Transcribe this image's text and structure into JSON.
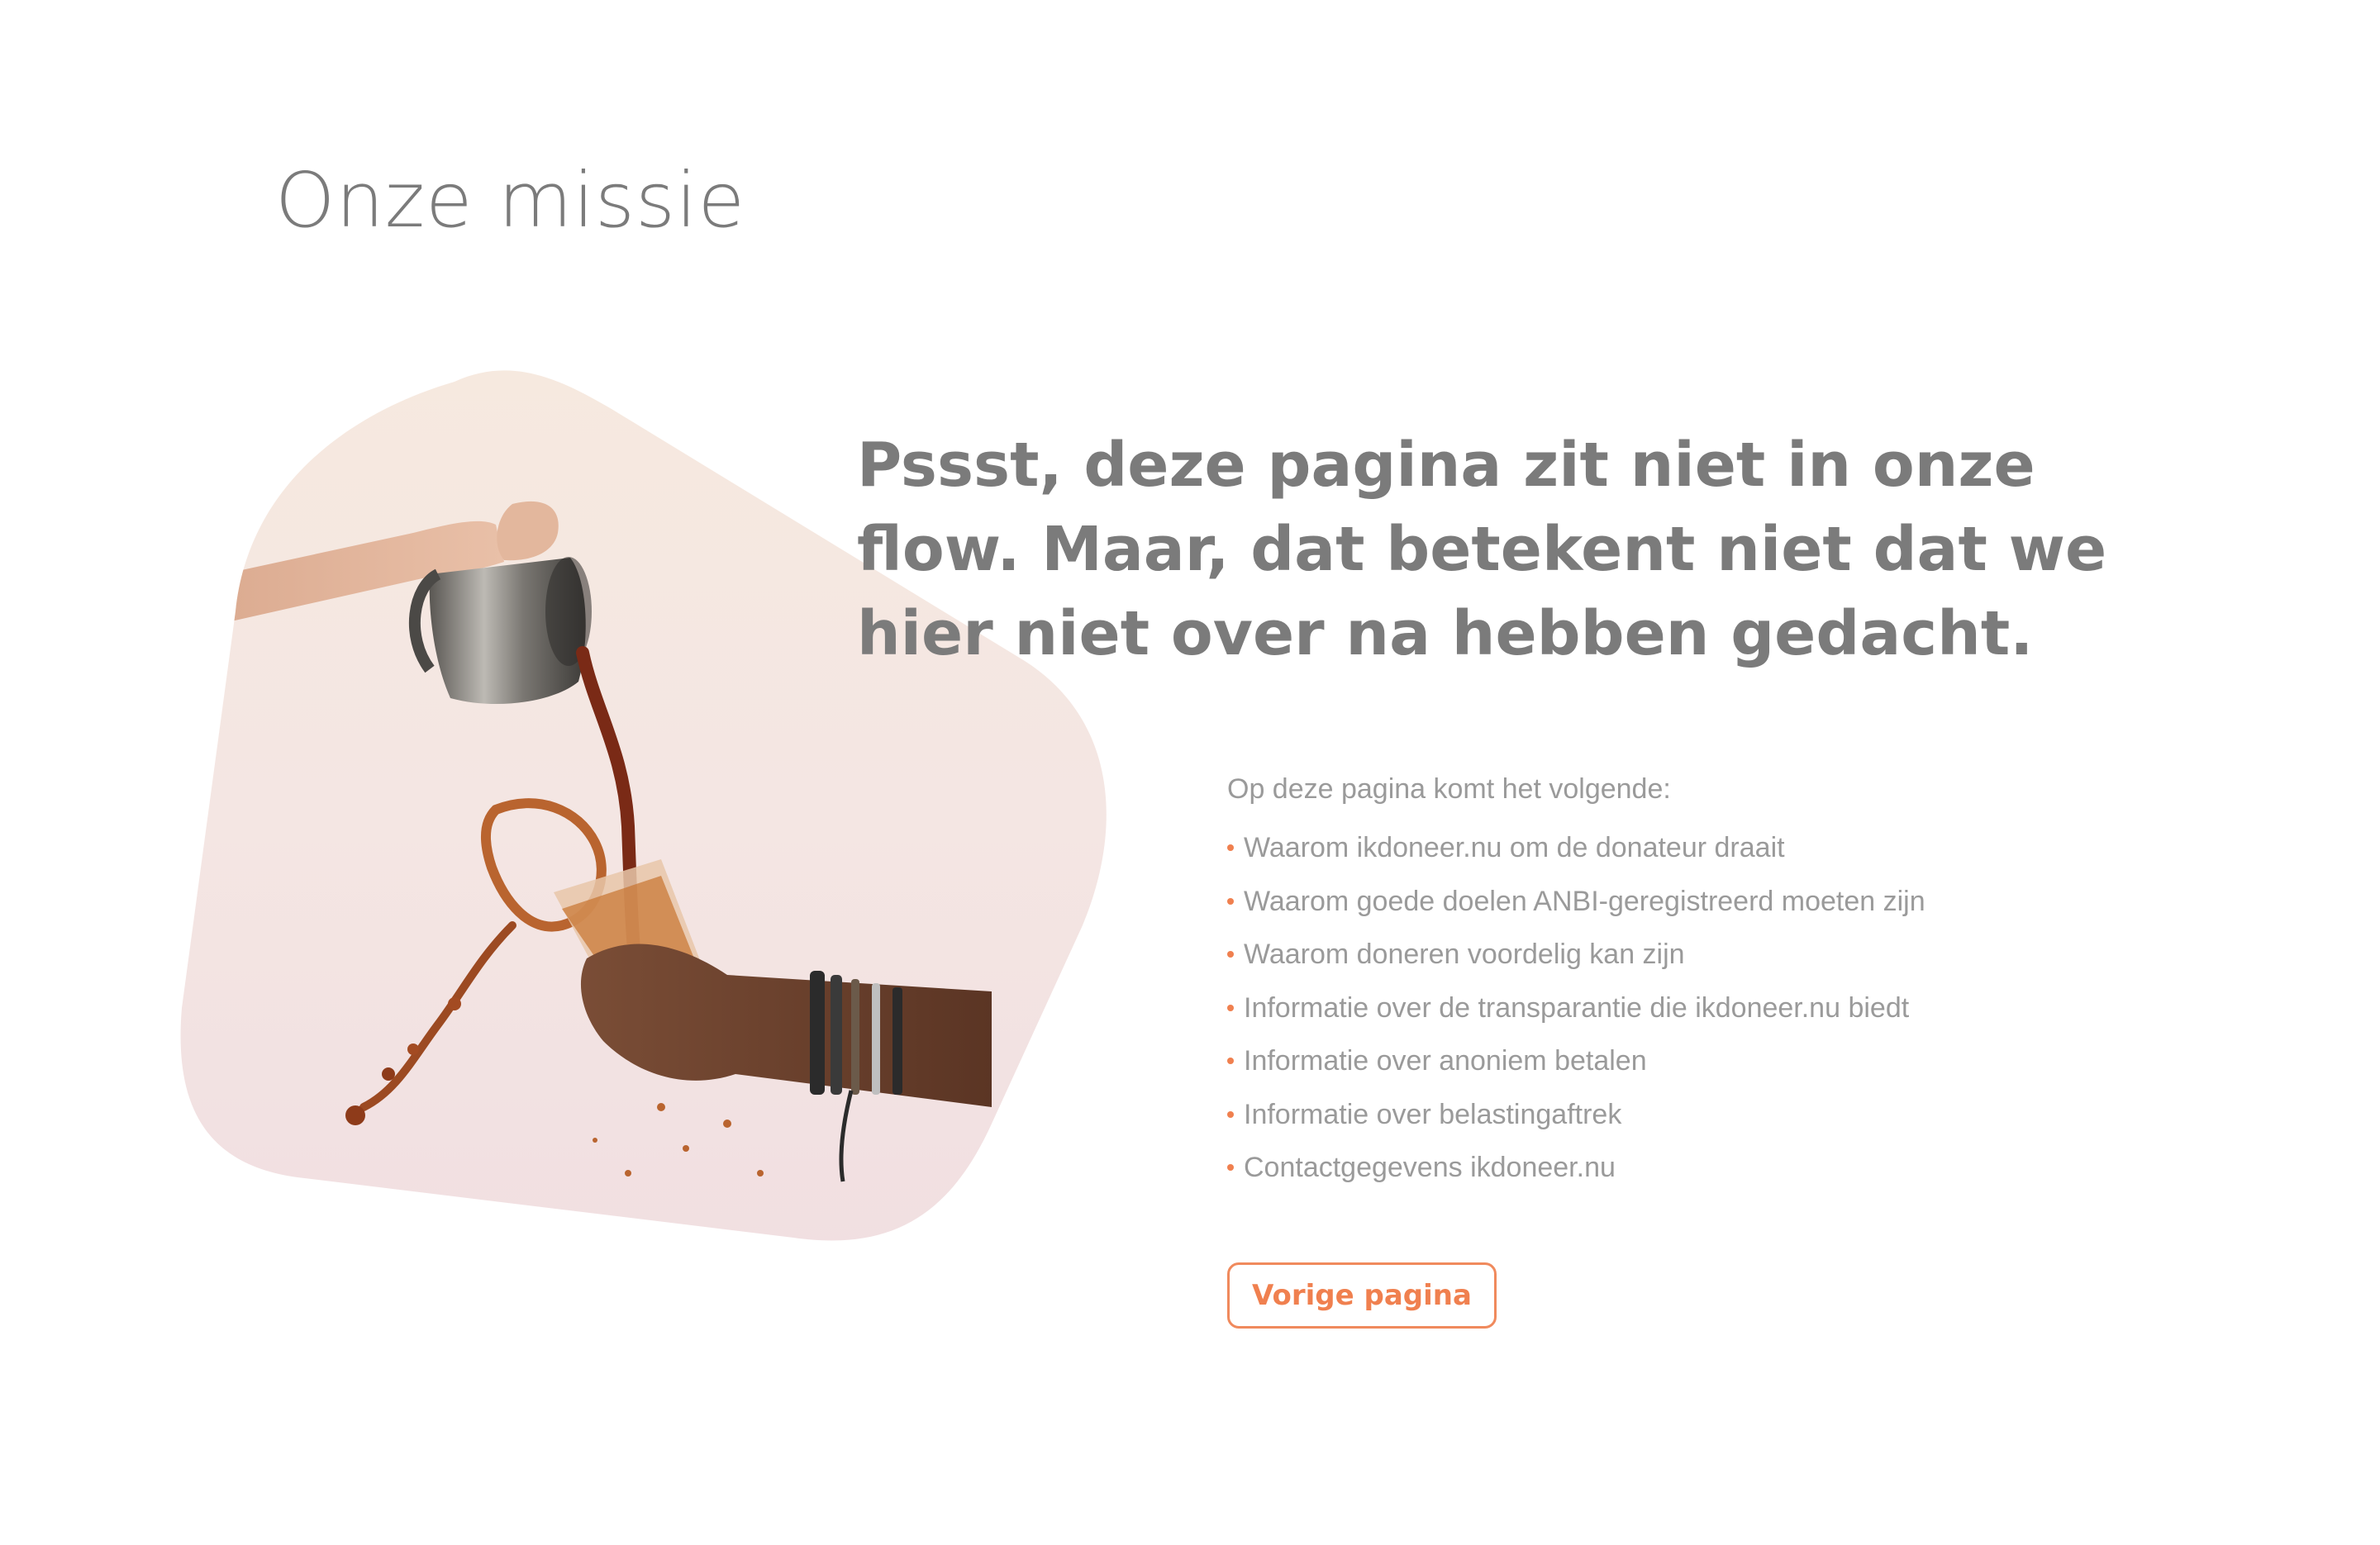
{
  "page": {
    "title": "Onze missie"
  },
  "hero": {
    "headline": "Pssst, deze pagina zit niet in onze\nflow.  Maar, dat betekent niet dat we\nhier niet over na hebben gedacht."
  },
  "content": {
    "intro": "Op deze pagina komt het volgende:",
    "items": [
      "Waarom ikdoneer.nu om de donateur draait",
      "Waarom goede doelen ANBI-geregistreerd moeten zijn",
      "Waarom doneren voordelig kan zijn",
      "Informatie over de transparantie die ikdoneer.nu biedt",
      "Informatie over anoniem betalen",
      "Informatie over belastingaftrek",
      "Contactgegevens ikdoneer.nu"
    ]
  },
  "actions": {
    "prev_label": "Vorige pagina"
  },
  "colors": {
    "accent": "#f0804f",
    "text": "#7b7b7b",
    "muted": "#9a9a9a"
  }
}
